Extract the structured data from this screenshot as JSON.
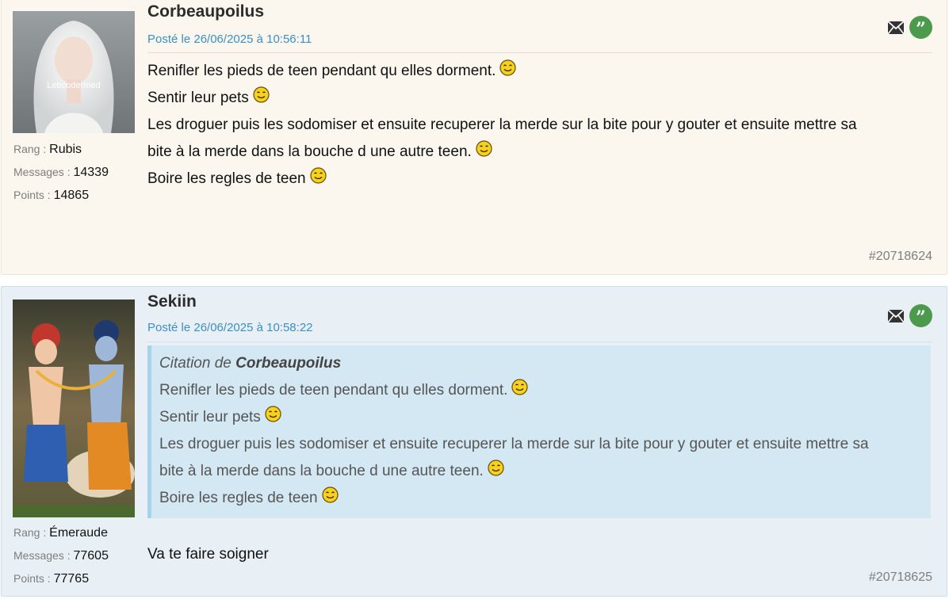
{
  "posts": [
    {
      "author": "Corbeaupoilus",
      "date": "Posté le 26/06/2025 à 10:56:11",
      "avatar_caption": "Lebcodermed",
      "stats": {
        "rang_label": "Rang",
        "rang": "Rubis",
        "messages_label": "Messages",
        "messages": "14339",
        "points_label": "Points",
        "points": "14865"
      },
      "lines": [
        "Renifler les pieds de teen pendant qu elles dorment.",
        "Sentir leur pets",
        "Les droguer puis les sodomiser et ensuite recuperer la merde sur la bite pour y gouter et ensuite mettre sa",
        "bite à la merde dans la bouche d une autre teen.",
        "Boire les regles de teen"
      ],
      "post_id": "#20718624"
    },
    {
      "author": "Sekiin",
      "date": "Posté le 26/06/2025 à 10:58:22",
      "stats": {
        "rang_label": "Rang",
        "rang": "Émeraude",
        "messages_label": "Messages",
        "messages": "77605",
        "points_label": "Points",
        "points": "77765"
      },
      "citation": {
        "prefix": "Citation de",
        "author": "Corbeaupoilus",
        "lines": [
          "Renifler les pieds de teen pendant qu elles dorment.",
          "Sentir leur pets",
          "Les droguer puis les sodomiser et ensuite recuperer la merde sur la bite pour y gouter et ensuite mettre sa",
          "bite à la merde dans la bouche d une autre teen.",
          "Boire les regles de teen"
        ]
      },
      "reply": "Va te faire soigner",
      "post_id": "#20718625"
    }
  ],
  "icons": {
    "mail": "mail-icon",
    "quote": "quote-icon",
    "emoji": "smiley-emoji-icon"
  },
  "colors": {
    "date": "#3d8ec4",
    "quote_button": "#4b9a4e",
    "citation_bg": "#d4e8f3"
  }
}
